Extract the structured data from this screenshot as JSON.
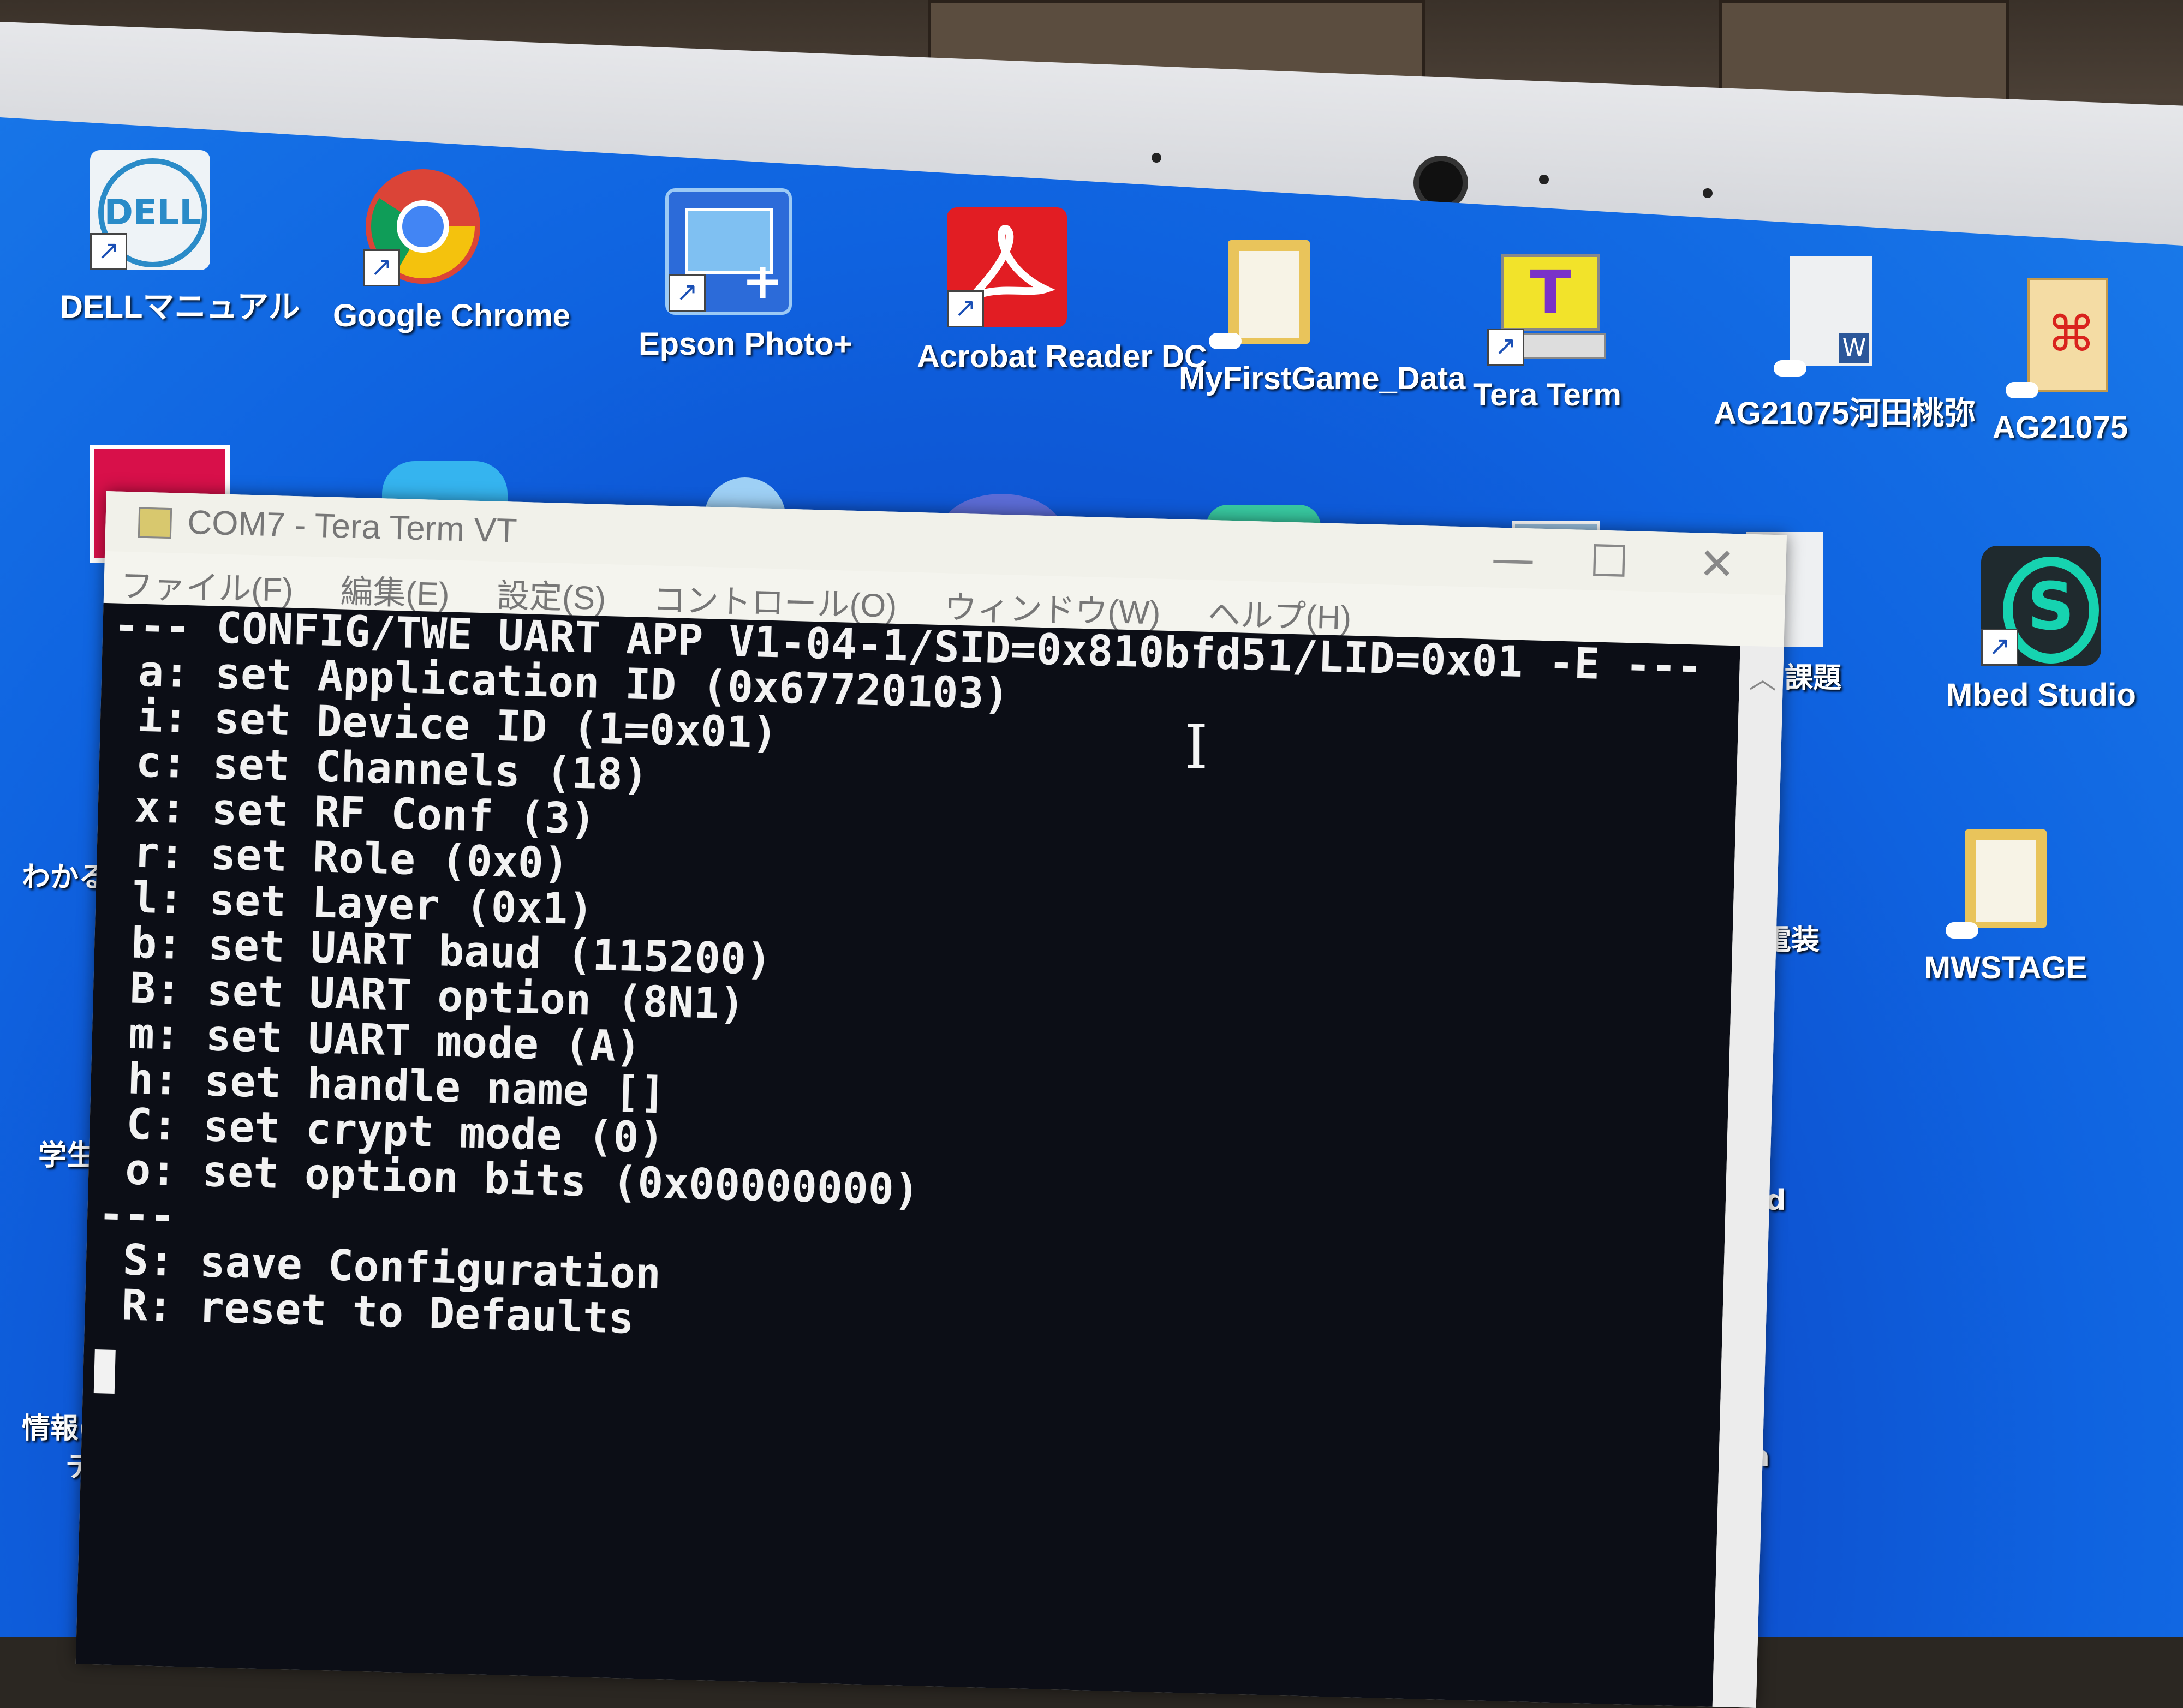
{
  "desktop": {
    "icons": [
      {
        "label": "DELLマニュアル",
        "icon": "dell-manual-icon"
      },
      {
        "label": "Google Chrome",
        "icon": "chrome-icon"
      },
      {
        "label": "Epson Photo+",
        "icon": "epson-photo-icon"
      },
      {
        "label": "Acrobat Reader DC",
        "icon": "acrobat-icon"
      },
      {
        "label": "MyFirstGame_Data",
        "icon": "folder-icon"
      },
      {
        "label": "Tera Term",
        "icon": "teraterm-icon"
      },
      {
        "label": "AG21075河田桃弥",
        "icon": "word-doc-icon"
      },
      {
        "label": "AG21075",
        "icon": "pdf-icon"
      },
      {
        "label": "Mbed Studio",
        "icon": "mbed-studio-icon"
      },
      {
        "label": "MWSTAGE",
        "icon": "folder-icon"
      }
    ],
    "partial_labels": [
      "わかる",
      "学生",
      "情報(",
      "デ",
      "課題",
      "電装",
      "ad",
      "on"
    ],
    "dell_logo_text": "DELL"
  },
  "window": {
    "title": "COM7 - Tera Term VT",
    "controls": {
      "minimize": "—",
      "maximize": "☐",
      "close": "✕"
    },
    "menu": [
      "ファイル(F)",
      "編集(E)",
      "設定(S)",
      "コントロール(O)",
      "ウィンドウ(W)",
      "ヘルプ(H)"
    ]
  },
  "terminal": {
    "lines": [
      "--- CONFIG/TWE UART APP V1-04-1/SID=0x810bfd51/LID=0x01 -E ---",
      " a: set Application ID (0x67720103)",
      " i: set Device ID (1=0x01)",
      " c: set Channels (18)",
      " x: set RF Conf (3)",
      " r: set Role (0x0)",
      " l: set Layer (0x1)",
      " b: set UART baud (115200)",
      " B: set UART option (8N1)",
      " m: set UART mode (A)",
      " h: set handle name []",
      " C: set crypt mode (0)",
      " o: set option bits (0x00000000)",
      "---",
      " S: save Configuration",
      " R: reset to Defaults"
    ]
  },
  "colors": {
    "desktop_blue": "#0f63e0",
    "terminal_bg": "#0c0e16",
    "terminal_fg": "#f2f2f2"
  }
}
